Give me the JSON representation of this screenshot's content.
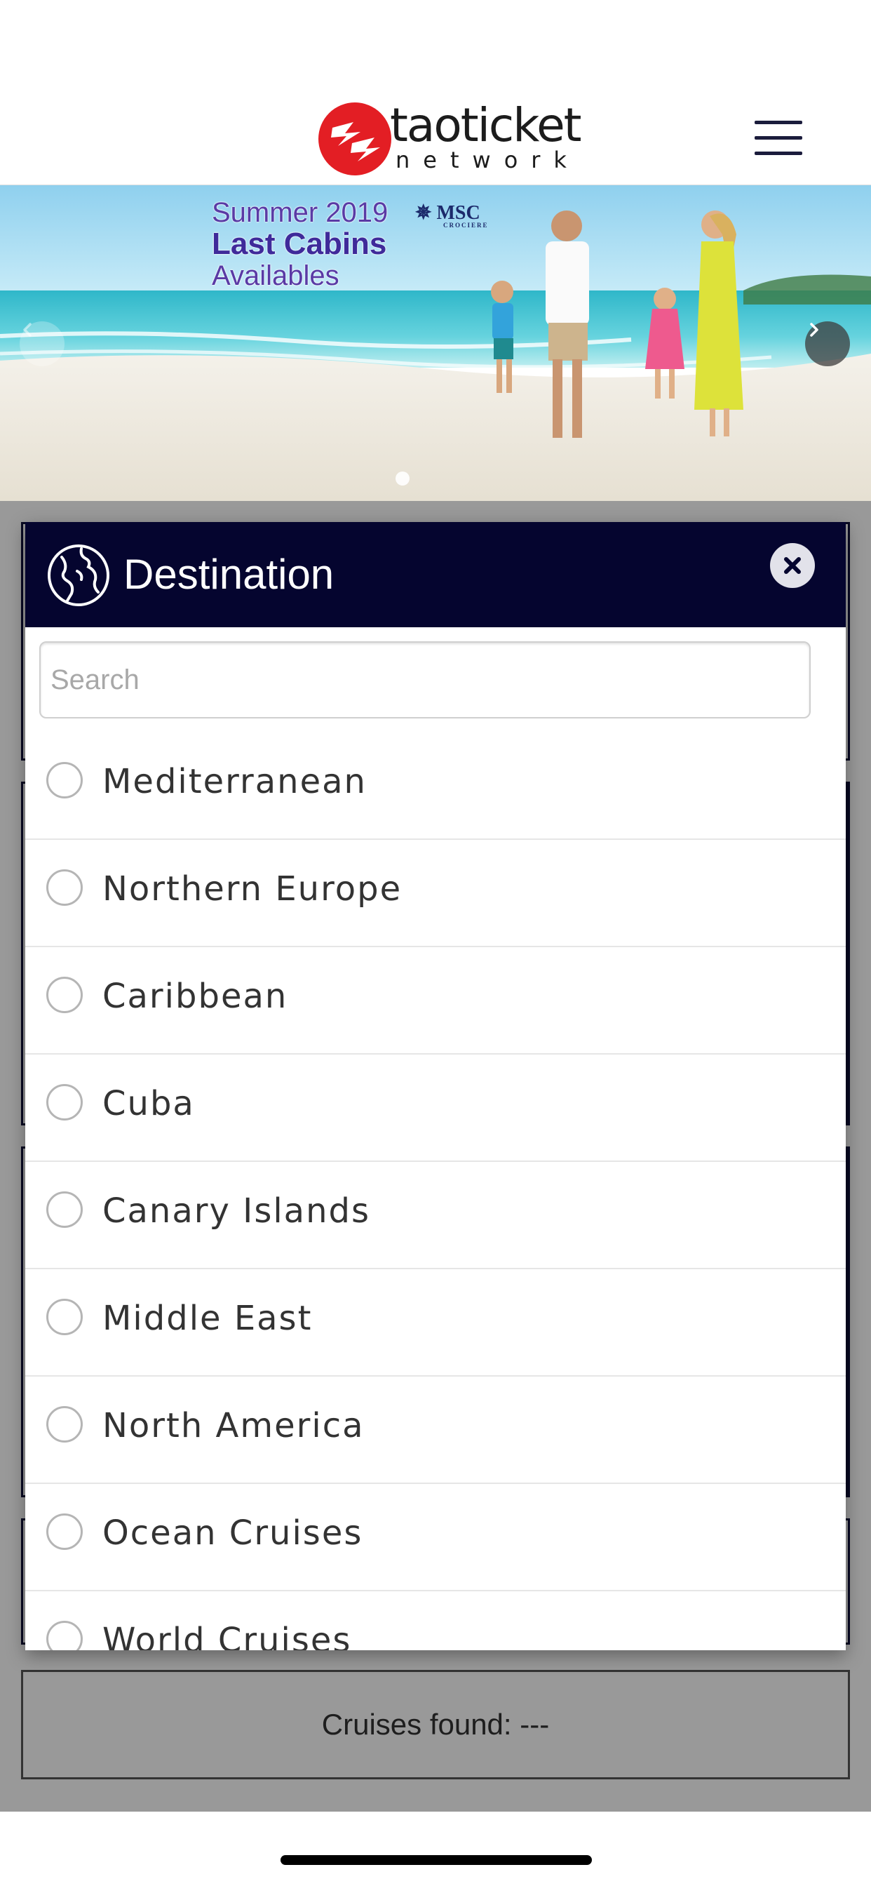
{
  "header": {
    "logo_name": "taoticket",
    "logo_sub": "network"
  },
  "hero": {
    "promo_line1": "Summer 2019",
    "promo_line2": "Last Cabins",
    "promo_line3": "Availables",
    "brand": "MSC",
    "brand_sub": "CROCIERE",
    "slide_count": 1,
    "active_slide": 1
  },
  "modal": {
    "title": "Destination",
    "search": {
      "placeholder": "Search",
      "value": ""
    },
    "destinations": [
      {
        "label": "Mediterranean",
        "selected": false
      },
      {
        "label": "Northern Europe",
        "selected": false
      },
      {
        "label": "Caribbean",
        "selected": false
      },
      {
        "label": "Cuba",
        "selected": false
      },
      {
        "label": "Canary Islands",
        "selected": false
      },
      {
        "label": "Middle East",
        "selected": false
      },
      {
        "label": "North America",
        "selected": false
      },
      {
        "label": "Ocean Cruises",
        "selected": false
      },
      {
        "label": "World Cruises",
        "selected": false
      }
    ]
  },
  "results": {
    "label": "Cruises found: ---"
  },
  "colors": {
    "navy": "#05052f",
    "logo_red": "#e31e24",
    "overlay": "rgba(0,0,0,0.40)"
  },
  "icons": [
    "menu-icon",
    "globe-icon",
    "close-icon",
    "chevron-left-icon",
    "chevron-right-icon",
    "radio-icon"
  ]
}
